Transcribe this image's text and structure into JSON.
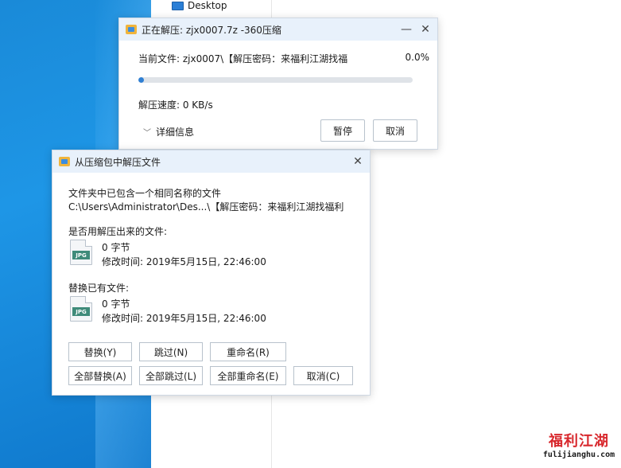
{
  "desktop": {
    "folder_label": "Desktop"
  },
  "progress_window": {
    "title": "正在解压: zjx0007.7z -360压缩",
    "current_file": "当前文件: zjx0007\\【解压密码：来福利江湖找福",
    "percent_text": "0.0%",
    "progress": 0.02,
    "speed": "解压速度: 0 KB/s",
    "details_label": "详细信息",
    "pause_label": "暂停",
    "cancel_label": "取消"
  },
  "conflict_dialog": {
    "title": "从压缩包中解压文件",
    "message_line1": "文件夹中已包含一个相同名称的文件",
    "message_line2": "C:\\Users\\Administrator\\Des...\\【解压密码：来福利江湖找福利",
    "use_extracted_label": "是否用解压出来的文件:",
    "extracted_file": {
      "icon_text": "JPG",
      "size": "0 字节",
      "modified": "修改时间: 2019年5月15日, 22:46:00"
    },
    "replace_existing_label": "替换已有文件:",
    "existing_file": {
      "icon_text": "JPG",
      "size": "0 字节",
      "modified": "修改时间: 2019年5月15日, 22:46:00"
    },
    "buttons": {
      "replace": "替换(Y)",
      "skip": "跳过(N)",
      "rename": "重命名(R)",
      "replace_all": "全部替换(A)",
      "skip_all": "全部跳过(L)",
      "rename_all": "全部重命名(E)",
      "cancel": "取消(C)"
    }
  },
  "watermark": {
    "main": "福利江湖",
    "sub": "fulijianghu.com"
  },
  "colors": {
    "accent": "#2f7fd3",
    "titlebar": "#e8f1fb",
    "watermark_red": "#d8282d"
  },
  "icons": [
    "minimize-icon",
    "close-icon",
    "chevron-down-icon",
    "jpg-file-icon",
    "app-360zip-icon",
    "monitor-icon"
  ]
}
